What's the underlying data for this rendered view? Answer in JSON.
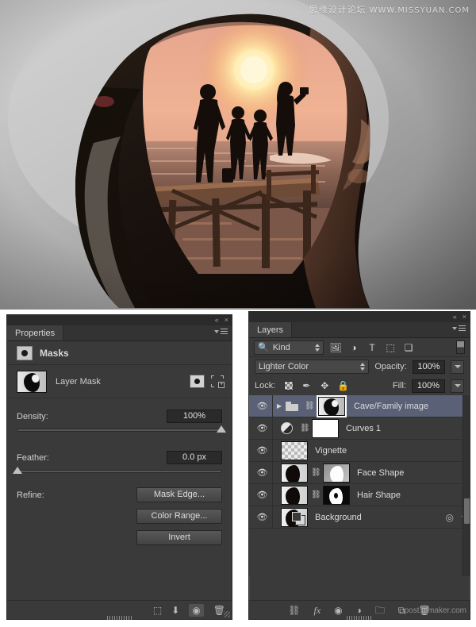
{
  "photo": {
    "alt_description": "Double-exposure composite: silhouette of a woman's head containing a beach sunset scene with a family of four standing on a wooden pier",
    "watermark_cn": "思缘设计论坛",
    "watermark_url": "WWW.MISSYUAN.COM"
  },
  "properties_panel": {
    "tab_label": "Properties",
    "collapse_icon": "«",
    "close_icon": "×",
    "menu_icon": "panel-menu-icon",
    "section_title": "Masks",
    "mask_row": {
      "label": "Layer Mask",
      "thumbnail_name": "layer-mask-thumbnail",
      "pixel_mask_icon": "pixel-mask-icon",
      "vector_mask_icon": "vector-mask-icon"
    },
    "density": {
      "label": "Density:",
      "value": "100%",
      "slider_position_pct": 100
    },
    "feather": {
      "label": "Feather:",
      "value": "0.0 px",
      "slider_position_pct": 0
    },
    "refine": {
      "label": "Refine:",
      "buttons": [
        {
          "label": "Mask Edge...",
          "name": "mask-edge-button"
        },
        {
          "label": "Color Range...",
          "name": "color-range-button"
        },
        {
          "label": "Invert",
          "name": "invert-button"
        }
      ]
    },
    "footer_icons": [
      {
        "name": "load-selection-from-mask-icon",
        "glyph": "⬚"
      },
      {
        "name": "apply-mask-icon",
        "glyph": "⬇"
      },
      {
        "name": "toggle-mask-visibility-icon",
        "glyph": "◉"
      },
      {
        "name": "delete-mask-icon",
        "glyph": "Ὕ1"
      }
    ]
  },
  "layers_panel": {
    "tab_label": "Layers",
    "collapse_icon": "«",
    "close_icon": "×",
    "menu_icon": "panel-menu-icon",
    "filter": {
      "kind_label": "Kind",
      "search_icon": "search-icon",
      "type_filters": [
        {
          "name": "filter-pixel-layers-icon",
          "glyph": "Ὓc"
        },
        {
          "name": "filter-adjustment-layers-icon",
          "glyph": "◐"
        },
        {
          "name": "filter-type-layers-icon",
          "glyph": "T"
        },
        {
          "name": "filter-shape-layers-icon",
          "glyph": "⬚"
        },
        {
          "name": "filter-smart-objects-icon",
          "glyph": "❐"
        }
      ],
      "toggle_name": "filter-enable-toggle"
    },
    "blend_mode": "Lighter Color",
    "opacity_label": "Opacity:",
    "opacity_value": "100%",
    "lock_label": "Lock:",
    "lock_icons": [
      {
        "name": "lock-transparent-pixels-icon",
        "glyph": "checker"
      },
      {
        "name": "lock-image-pixels-icon",
        "glyph": "✐"
      },
      {
        "name": "lock-position-icon",
        "glyph": "✥"
      },
      {
        "name": "lock-all-icon",
        "glyph": "ὑ2"
      }
    ],
    "fill_label": "Fill:",
    "fill_value": "100%",
    "rows": [
      {
        "name": "Cave/Family image",
        "selected": true,
        "kind": "group",
        "has_expand_arrow": true,
        "has_folder_icon": true,
        "has_link_icon": true,
        "thumb_style": "cave",
        "thumb_framed": true,
        "visible": true
      },
      {
        "name": "Curves 1",
        "selected": false,
        "kind": "adjustment",
        "has_adjustment_icon": true,
        "has_link_icon": true,
        "thumb_style": "white",
        "thumb_framed": false,
        "visible": true
      },
      {
        "name": "Vignette",
        "selected": false,
        "kind": "pixel",
        "thumb_style": "checkered",
        "thumb_framed": false,
        "visible": true
      },
      {
        "name": "Face Shape",
        "selected": false,
        "kind": "pixel",
        "has_link_icon": true,
        "thumb_style": "portrait",
        "mask_style": "maskw",
        "thumb_framed": false,
        "visible": true
      },
      {
        "name": "Hair Shape",
        "selected": false,
        "kind": "pixel",
        "has_link_icon": true,
        "thumb_style": "portrait",
        "mask_style": "maskb",
        "thumb_framed": false,
        "visible": true
      },
      {
        "name": "Background",
        "selected": false,
        "kind": "background",
        "thumb_style": "portrait",
        "thumb_framed": false,
        "has_background_badge": true,
        "has_style_icon": true,
        "has_row_caret": true,
        "visible": true
      }
    ],
    "footer_icons": [
      {
        "name": "link-layers-icon",
        "glyph": "⚭"
      },
      {
        "name": "layer-style-icon",
        "glyph": "fx"
      },
      {
        "name": "add-layer-mask-icon",
        "glyph": "◉"
      },
      {
        "name": "new-adjustment-layer-icon",
        "glyph": "◐"
      },
      {
        "name": "new-group-icon",
        "glyph": "὜0"
      },
      {
        "name": "new-layer-icon",
        "glyph": "⧉"
      },
      {
        "name": "delete-layer-icon",
        "glyph": "Ὕ1"
      }
    ],
    "footer_watermark": "post.uimaker.com"
  },
  "colors": {
    "panel_bg": "#3a3a3a",
    "panel_dark": "#2b2b2b",
    "selected_row": "#5a6177",
    "text": "#cfcfcf",
    "field_bg": "#2a2a2a"
  }
}
